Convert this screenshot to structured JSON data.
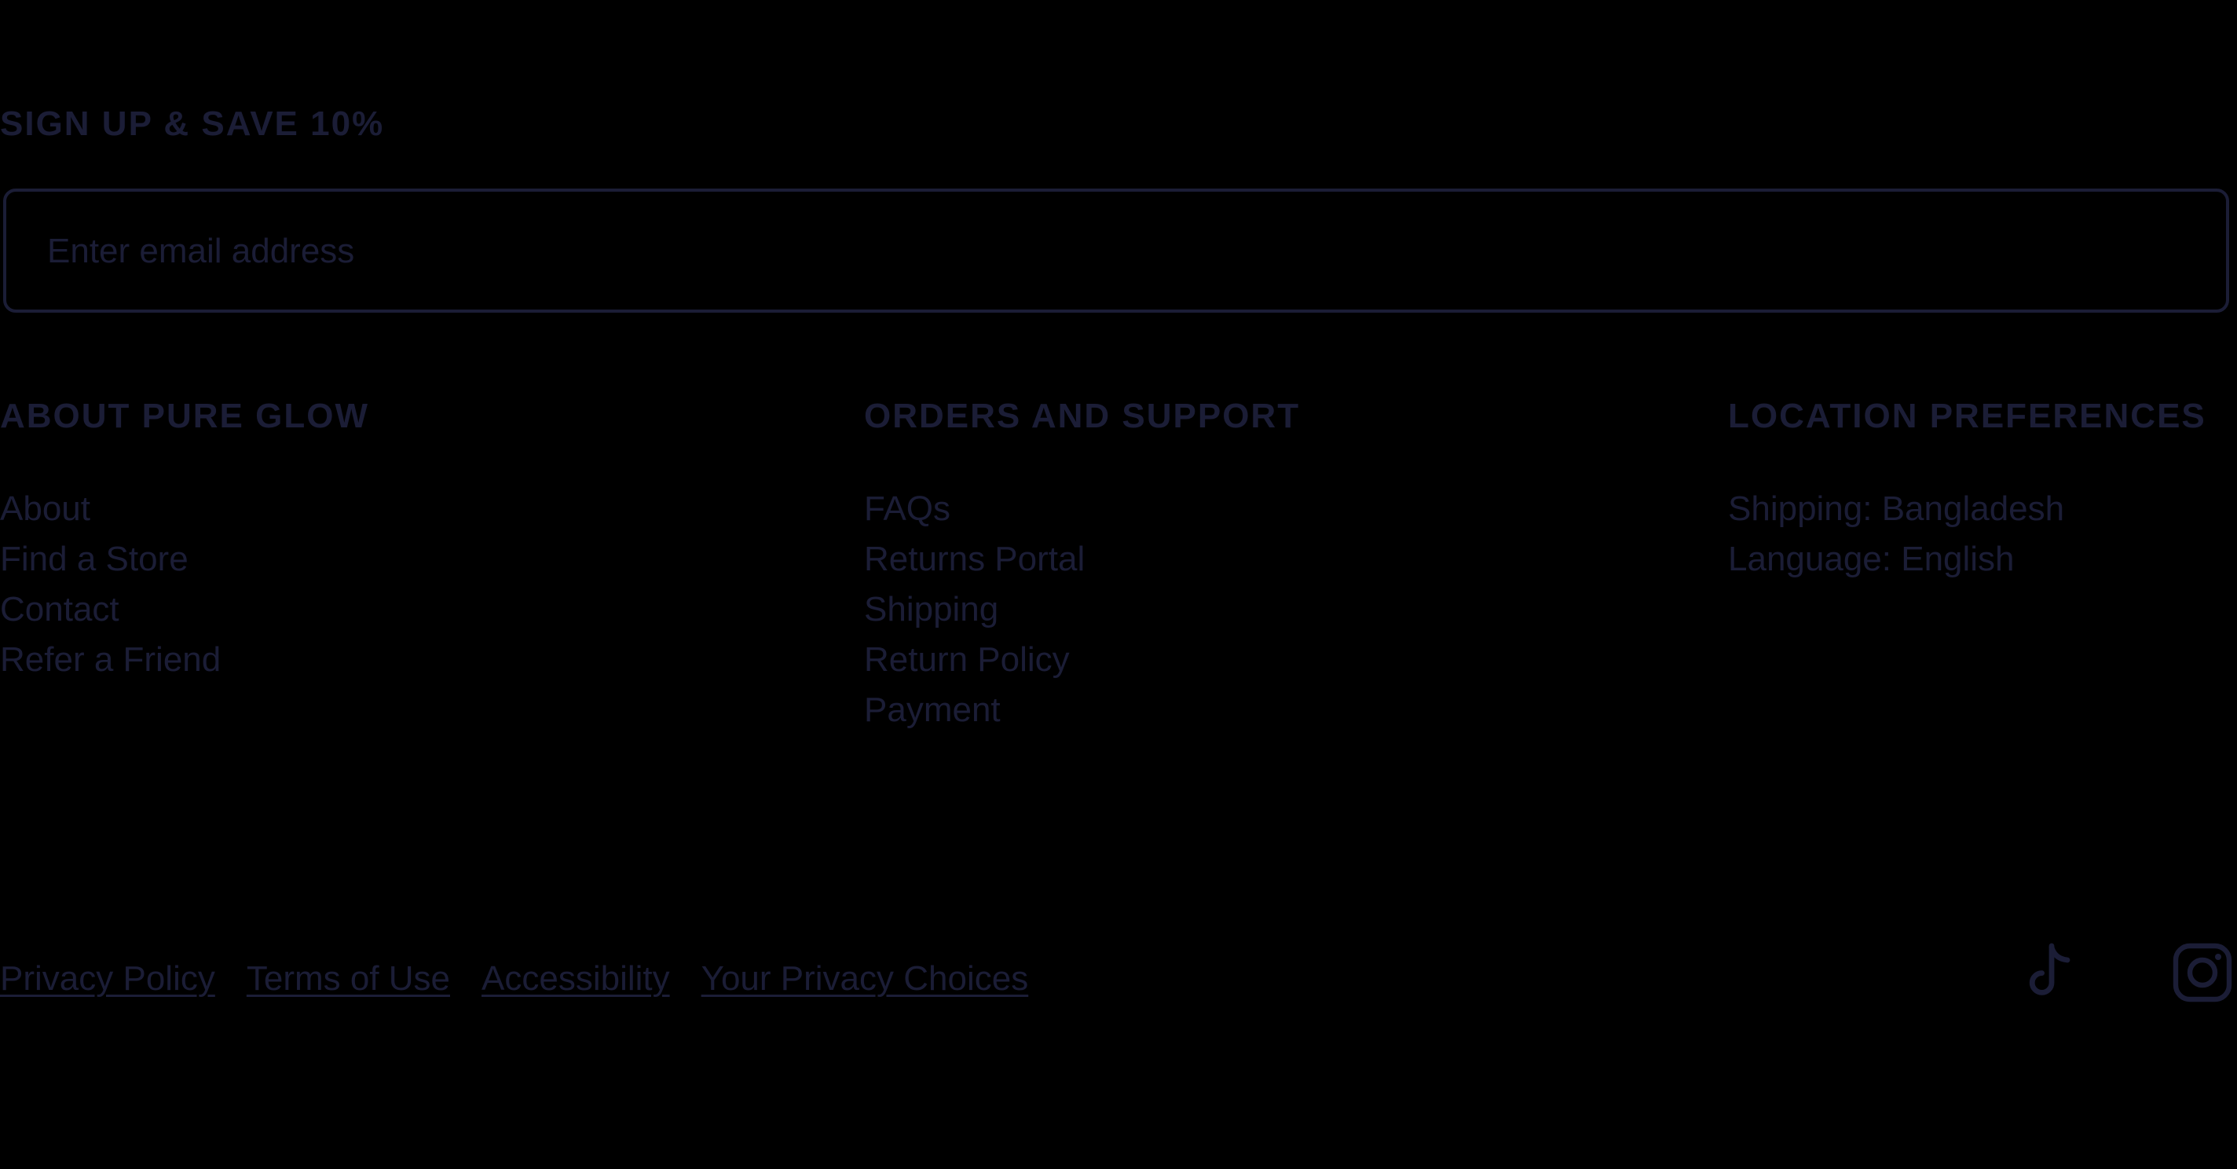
{
  "signup": {
    "heading": "SIGN UP & SAVE 10%",
    "email_placeholder": "Enter email address"
  },
  "columns": [
    {
      "heading": "ABOUT PURE GLOW",
      "links": [
        "About",
        "Find a Store",
        "Contact",
        "Refer a Friend"
      ]
    },
    {
      "heading": "ORDERS AND SUPPORT",
      "links": [
        "FAQs",
        "Returns Portal",
        "Shipping",
        "Return Policy",
        "Payment"
      ]
    },
    {
      "heading": "LOCATION PREFERENCES",
      "links": [
        "Shipping: Bangladesh",
        "Language: English"
      ]
    }
  ],
  "legal_links": [
    "Privacy Policy",
    "Terms of Use",
    "Accessibility",
    "Your Privacy Choices"
  ],
  "social": {
    "icons": [
      "tiktok-icon",
      "instagram-icon"
    ]
  },
  "colors": {
    "background": "#000000",
    "text": "#1b1d36"
  }
}
